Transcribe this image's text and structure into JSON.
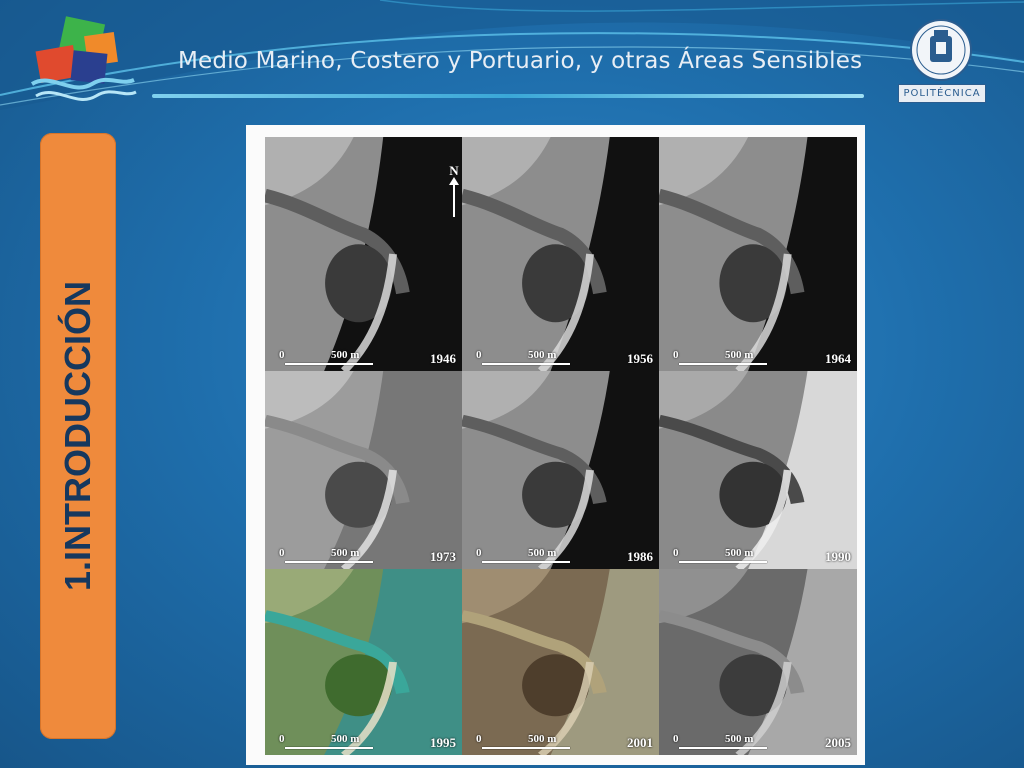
{
  "header": {
    "title": "Medio Marino, Costero y Portuario, y otras Áreas Sensibles",
    "university_badge": "POLITÉCNICA"
  },
  "sidebar": {
    "section_label": "1.INTRODUCCIÓN"
  },
  "figure": {
    "north_label": "N",
    "tiles": [
      {
        "year": "1946",
        "scale_zero": "0",
        "scale_label": "500 m",
        "style": "bw-dark-sea"
      },
      {
        "year": "1956",
        "scale_zero": "0",
        "scale_label": "500 m",
        "style": "bw-dark-sea"
      },
      {
        "year": "1964",
        "scale_zero": "0",
        "scale_label": "500 m",
        "style": "bw-dark-sea"
      },
      {
        "year": "1973",
        "scale_zero": "0",
        "scale_label": "500 m",
        "style": "bw-gray"
      },
      {
        "year": "1986",
        "scale_zero": "0",
        "scale_label": "500 m",
        "style": "bw-dark-sea"
      },
      {
        "year": "1990",
        "scale_zero": "0",
        "scale_label": "500 m",
        "style": "bw-light-sea"
      },
      {
        "year": "1995",
        "scale_zero": "0",
        "scale_label": "500 m",
        "style": "color-green"
      },
      {
        "year": "2001",
        "scale_zero": "0",
        "scale_label": "500 m",
        "style": "color-brown"
      },
      {
        "year": "2005",
        "scale_zero": "0",
        "scale_label": "500 m",
        "style": "bw-gray-waves"
      }
    ]
  },
  "colors": {
    "background": "#1f6fad",
    "side_panel": "#ef8a3c",
    "side_text": "#16385e",
    "title_text": "#e8eef5",
    "rule": "#3aa7d7"
  },
  "icons": {
    "left_logo": "wave-squares-logo",
    "right_logo": "university-crest-icon"
  }
}
